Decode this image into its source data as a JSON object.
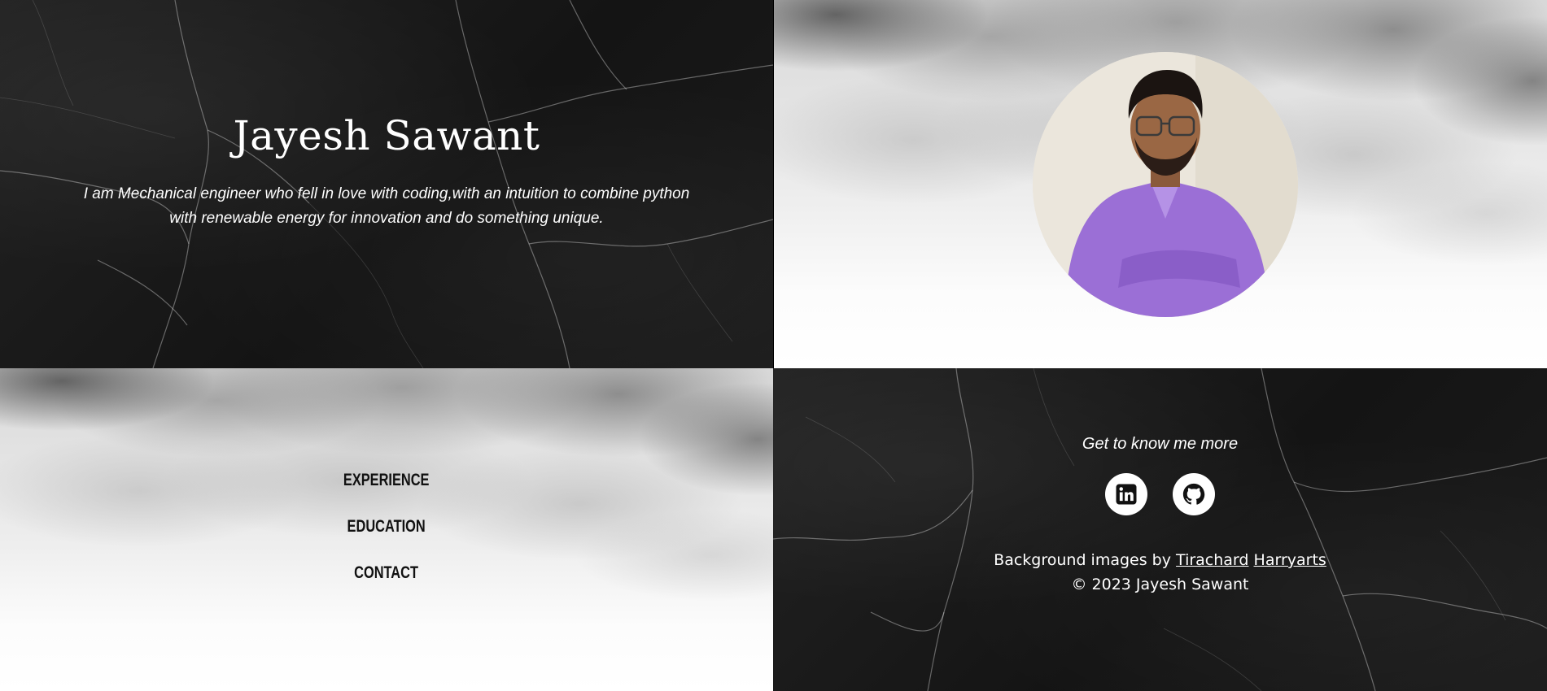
{
  "hero": {
    "title": "Jayesh Sawant",
    "text_line1": "I am Mechanical engineer who fell in love with coding,with an intuition to combine python",
    "text_line2": "with renewable energy for innovation and do something unique."
  },
  "profile": {
    "photo_alt": "Jayesh Sawant"
  },
  "nav": {
    "items": [
      {
        "label": "EXPERIENCE"
      },
      {
        "label": "EDUCATION"
      },
      {
        "label": "CONTACT"
      }
    ]
  },
  "footer": {
    "tagline": "Get to know me more",
    "social": [
      {
        "icon": "linkedin-icon"
      },
      {
        "icon": "github-icon"
      }
    ],
    "credits_prefix": "Background images by",
    "credit_link_1": "Tirachard",
    "credit_link_2": "Harryarts",
    "copyright": "© 2023 Jayesh Sawant"
  },
  "colors": {
    "dark_panel": "#1a1a1a",
    "light_panel": "#f2f2f2",
    "text_on_dark": "#ffffff",
    "text_on_light": "#111111",
    "shirt": "#9b6fd6"
  }
}
